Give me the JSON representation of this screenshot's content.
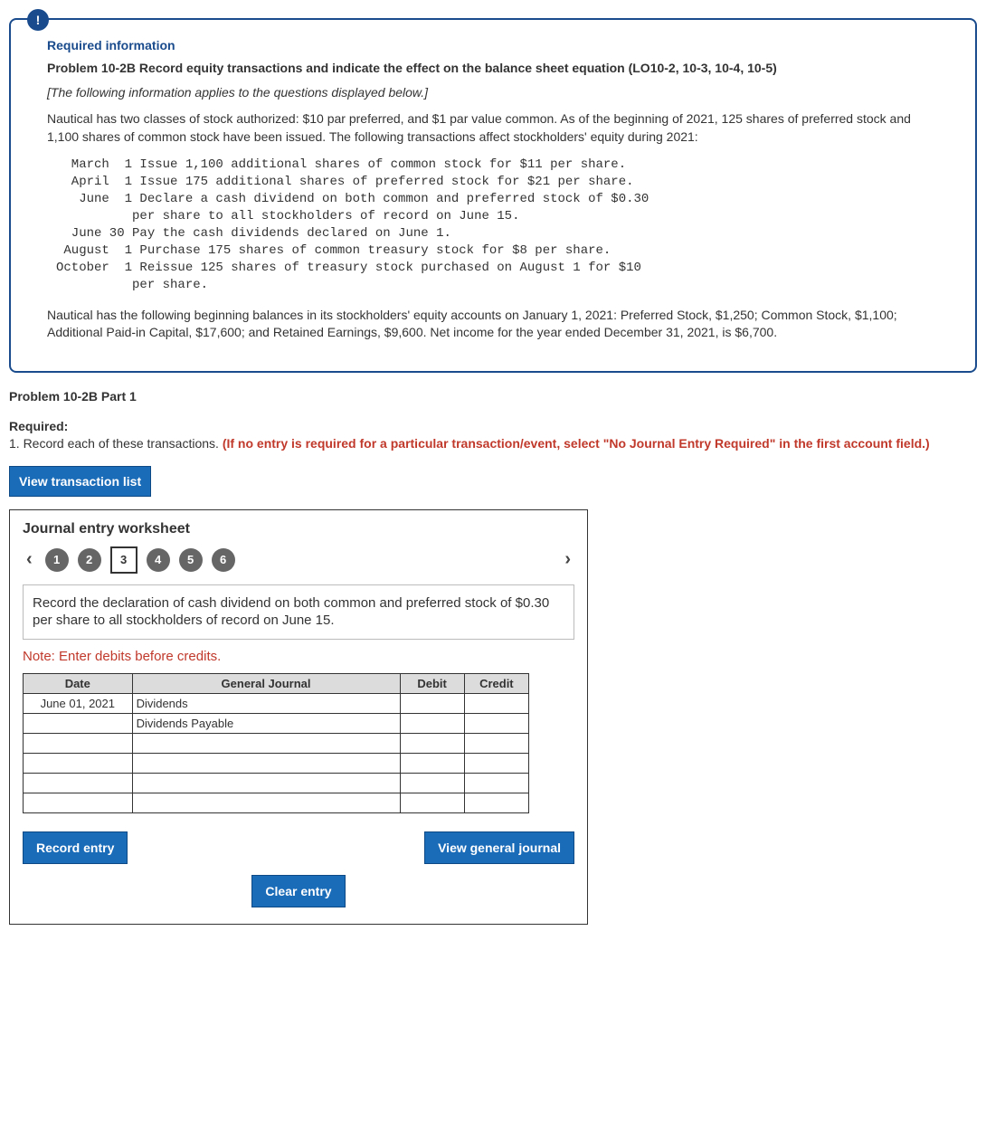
{
  "info_badge": "!",
  "required_info_heading": "Required information",
  "problem_title": "Problem 10-2B Record equity transactions and indicate the effect on the balance sheet equation (LO10-2, 10-3, 10-4, 10-5)",
  "applies_note": "[The following information applies to the questions displayed below.]",
  "intro_para": "Nautical has two classes of stock authorized: $10 par preferred, and $1 par value common. As of the beginning of 2021, 125 shares of preferred stock and 1,100 shares of common stock have been issued. The following transactions affect stockholders' equity during 2021:",
  "transactions_block": "  March  1 Issue 1,100 additional shares of common stock for $11 per share.\n  April  1 Issue 175 additional shares of preferred stock for $21 per share.\n   June  1 Declare a cash dividend on both common and preferred stock of $0.30\n          per share to all stockholders of record on June 15.\n  June 30 Pay the cash dividends declared on June 1.\n August  1 Purchase 175 shares of common treasury stock for $8 per share.\nOctober  1 Reissue 125 shares of treasury stock purchased on August 1 for $10\n          per share.",
  "balances_para": "Nautical has the following beginning balances in its stockholders' equity accounts on January 1, 2021: Preferred Stock, $1,250; Common Stock, $1,100; Additional Paid-in Capital, $17,600; and Retained Earnings, $9,600. Net income for the year ended December 31, 2021, is $6,700.",
  "part_heading": "Problem 10-2B Part 1",
  "required_label": "Required:",
  "required_line_lead": "1. Record each of these transactions. ",
  "required_line_red": "(If no entry is required for a particular transaction/event, select \"No Journal Entry Required\" in the first account field.)",
  "view_trans_btn": "View transaction list",
  "worksheet_heading": "Journal entry worksheet",
  "nav_items": [
    "1",
    "2",
    "3",
    "4",
    "5",
    "6"
  ],
  "instruction": "Record the declaration of cash dividend on both common and preferred stock of $0.30 per share to all stockholders of record on June 15.",
  "note_text": "Note: Enter debits before credits.",
  "table": {
    "headers": {
      "date": "Date",
      "gj": "General Journal",
      "debit": "Debit",
      "credit": "Credit"
    },
    "rows": [
      {
        "date": "June 01, 2021",
        "account": "Dividends",
        "debit": "",
        "credit": ""
      },
      {
        "date": "",
        "account": "Dividends Payable",
        "debit": "",
        "credit": ""
      },
      {
        "date": "",
        "account": "",
        "debit": "",
        "credit": ""
      },
      {
        "date": "",
        "account": "",
        "debit": "",
        "credit": ""
      },
      {
        "date": "",
        "account": "",
        "debit": "",
        "credit": ""
      },
      {
        "date": "",
        "account": "",
        "debit": "",
        "credit": ""
      }
    ]
  },
  "buttons": {
    "record": "Record entry",
    "clear": "Clear entry",
    "view_gj": "View general journal"
  }
}
